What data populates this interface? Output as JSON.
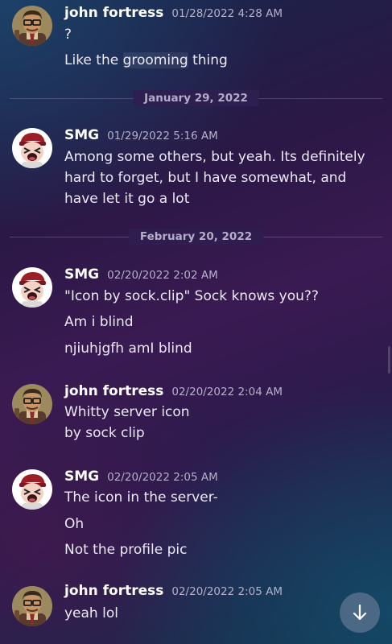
{
  "messages": [
    {
      "author": "john fortress",
      "timestamp": "01/28/2022 4:28 AM",
      "avatar": "john-avatar",
      "lines": [
        "?",
        "Like the grooming thing"
      ]
    },
    {
      "author": "SMG",
      "timestamp": "01/29/2022 5:16 AM",
      "avatar": "smg-avatar",
      "lines": [
        "Among some others, but yeah. Its definitely hard to forget, but I have somewhat, and have let it go a lot"
      ]
    },
    {
      "author": "SMG",
      "timestamp": "02/20/2022 2:02 AM",
      "avatar": "smg-avatar",
      "lines": [
        "\"Icon by sock.clip\" Sock  knows you??",
        "Am i blind",
        "njiuhjgfh amI blind"
      ]
    },
    {
      "author": "john fortress",
      "timestamp": "02/20/2022 2:04 AM",
      "avatar": "john-avatar",
      "lines": [
        "Whitty server icon by sock clip"
      ]
    },
    {
      "author": "SMG",
      "timestamp": "02/20/2022 2:05 AM",
      "avatar": "smg-avatar",
      "lines": [
        "The icon in the server-",
        "Oh",
        "Not the profile pic"
      ]
    },
    {
      "author": "john fortress",
      "timestamp": "02/20/2022 2:05 AM",
      "avatar": "john-avatar",
      "lines": [
        "yeah lol"
      ]
    }
  ],
  "dividers": [
    "January 29, 2022",
    "February 20, 2022"
  ],
  "highlight_word": "grooming",
  "scroll_button_icon": "arrow-down-icon",
  "colors": {
    "author": "#ffffff",
    "timestamp": "#b5b0c8",
    "message": "#ece9f6",
    "divider_label": "#b3adc8"
  }
}
